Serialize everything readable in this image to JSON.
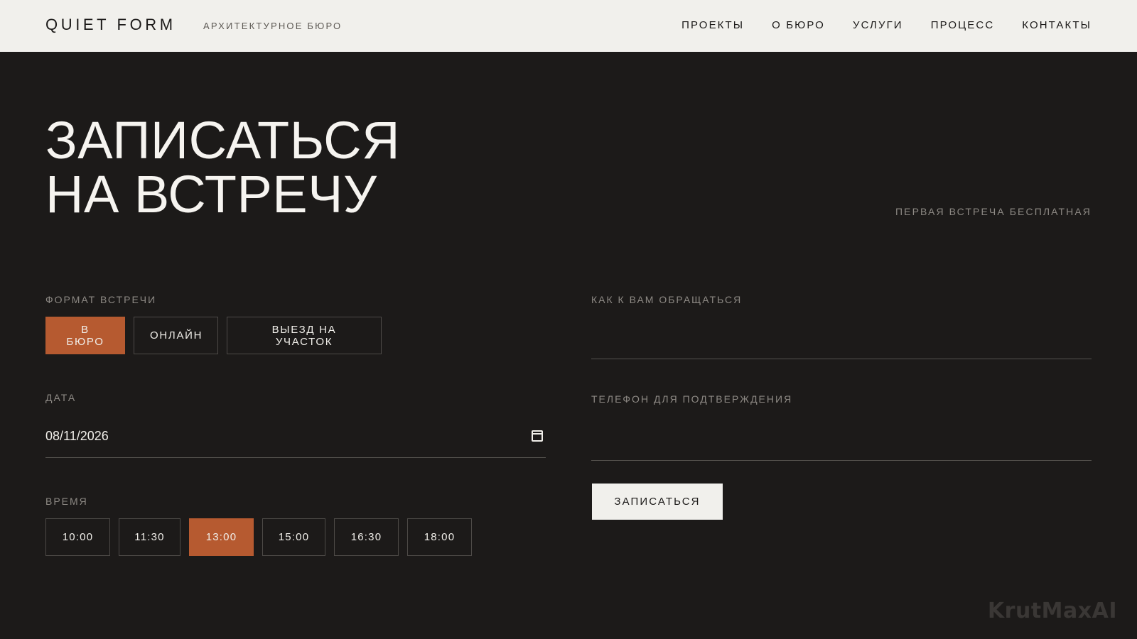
{
  "header": {
    "logo": "QUIET FORM",
    "tagline": "АРХИТЕКТУРНОЕ БЮРО",
    "nav": [
      "ПРОЕКТЫ",
      "О БЮРО",
      "УСЛУГИ",
      "ПРОЦЕСС",
      "КОНТАКТЫ"
    ]
  },
  "hero": {
    "title_line1": "ЗАПИСАТЬСЯ",
    "title_line2": "НА ВСТРЕЧУ",
    "note": "ПЕРВАЯ ВСТРЕЧА БЕСПЛАТНАЯ"
  },
  "form": {
    "format": {
      "label": "ФОРМАТ ВСТРЕЧИ",
      "options": [
        "В БЮРО",
        "ОНЛАЙН",
        "ВЫЕЗД НА УЧАСТОК"
      ],
      "selected": "В БЮРО"
    },
    "date": {
      "label": "ДАТА",
      "value": "08/11/2026"
    },
    "time": {
      "label": "ВРЕМЯ",
      "slots": [
        "10:00",
        "11:30",
        "13:00",
        "15:00",
        "16:30",
        "18:00"
      ],
      "selected": "13:00"
    },
    "name": {
      "label": "КАК К ВАМ ОБРАЩАТЬСЯ",
      "value": ""
    },
    "phone": {
      "label": "ТЕЛЕФОН ДЛЯ ПОДТВЕРЖДЕНИЯ",
      "value": ""
    },
    "submit_label": "ЗАПИСАТЬСЯ"
  },
  "colors": {
    "background": "#1c1a19",
    "header": "#f1f0ec",
    "accent": "#b65a30"
  },
  "icons": {
    "date": "calendar-icon"
  },
  "watermark": "KrutMaxAI"
}
